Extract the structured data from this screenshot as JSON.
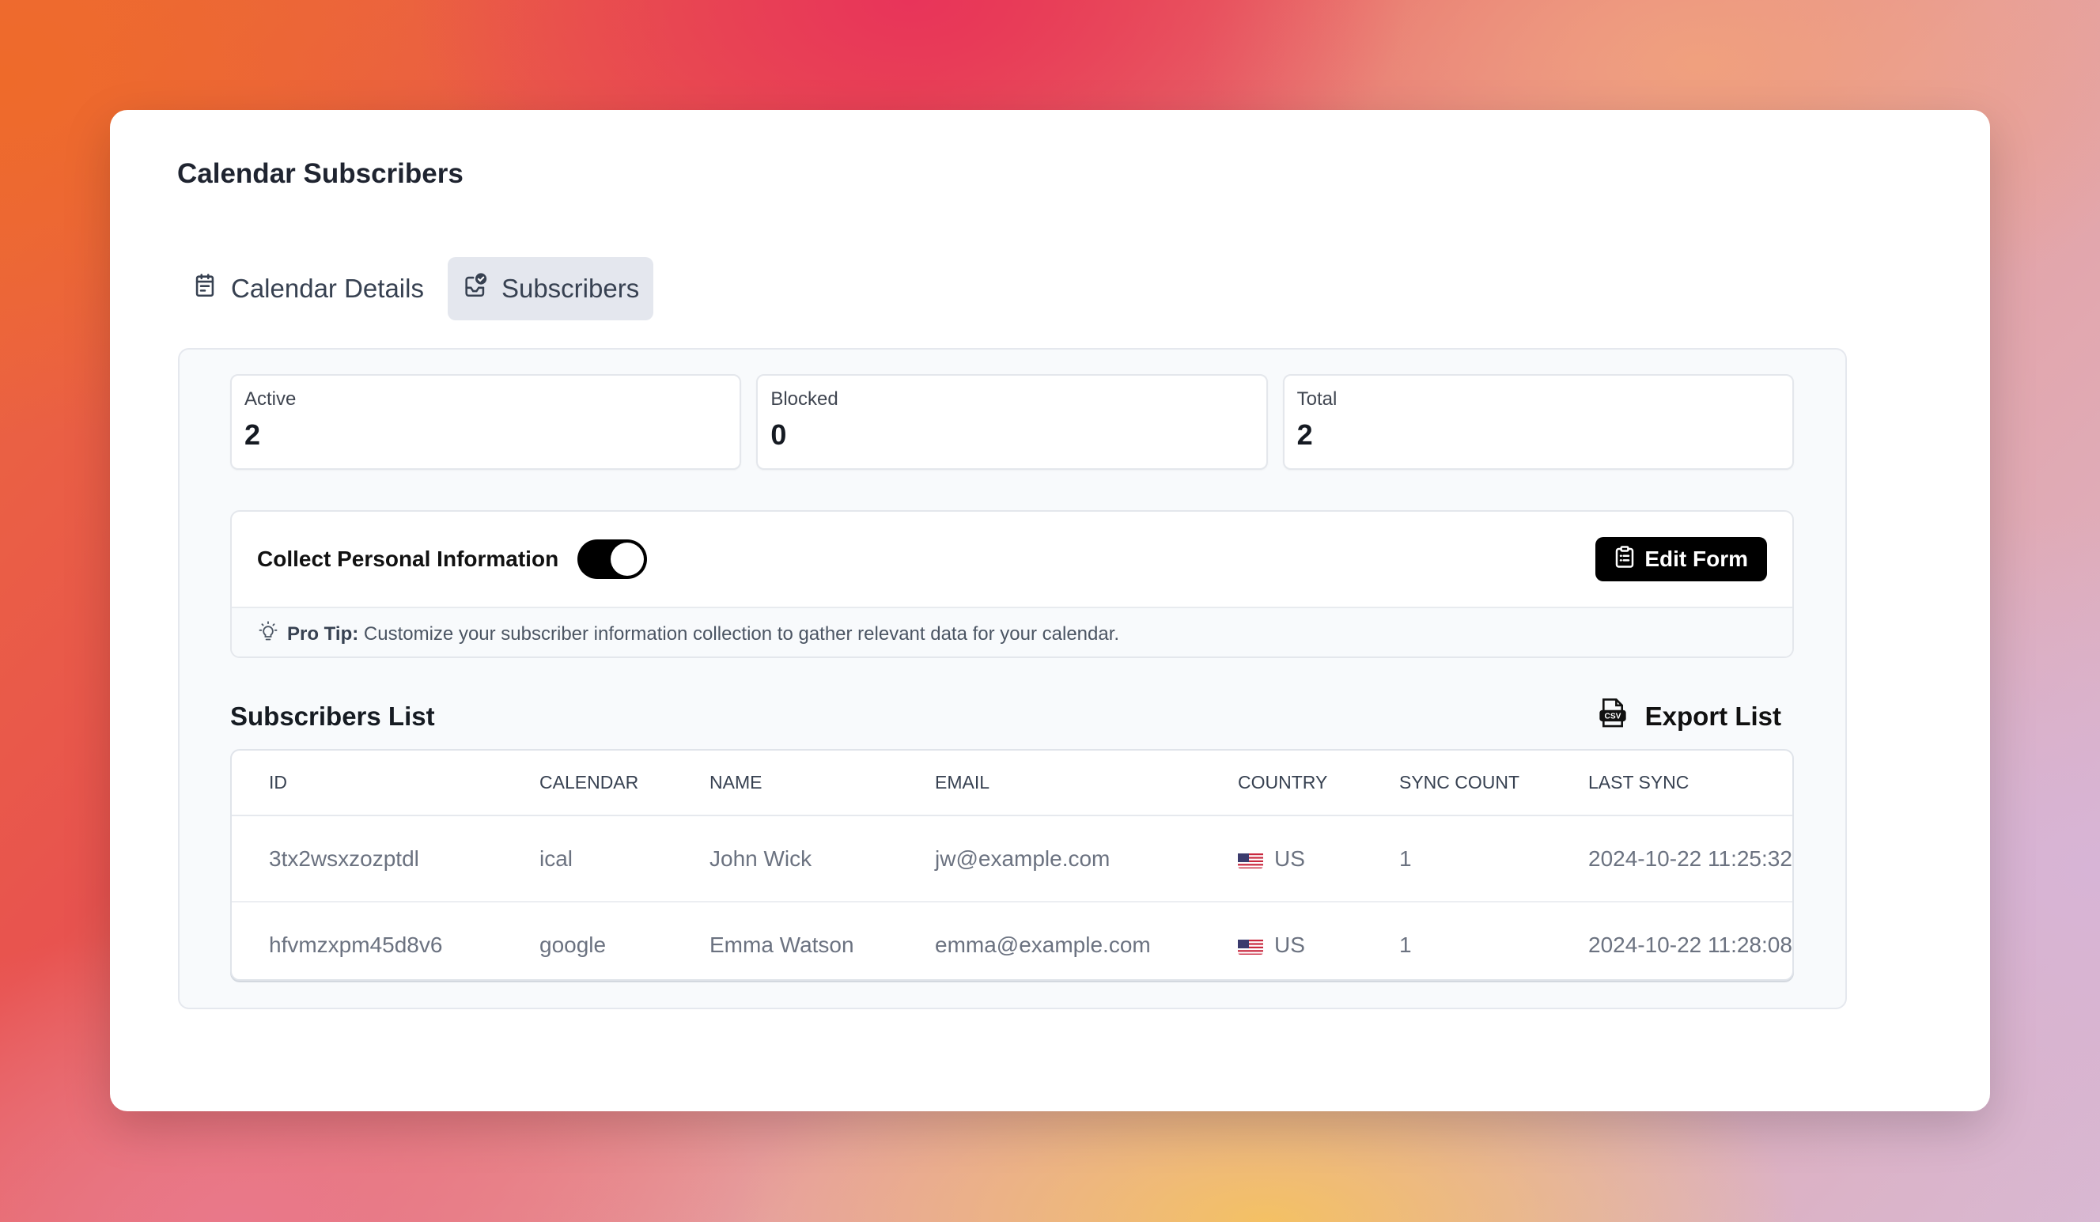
{
  "page": {
    "title": "Calendar Subscribers"
  },
  "tabs": [
    {
      "label": "Calendar Details",
      "icon": "calendar-icon",
      "active": false
    },
    {
      "label": "Subscribers",
      "icon": "subscribers-check-icon",
      "active": true
    }
  ],
  "stats": [
    {
      "label": "Active",
      "value": "2"
    },
    {
      "label": "Blocked",
      "value": "0"
    },
    {
      "label": "Total",
      "value": "2"
    }
  ],
  "settings": {
    "collect_label": "Collect Personal Information",
    "collect_enabled": true,
    "edit_form_label": "Edit Form",
    "tip_label": "Pro Tip:",
    "tip_text": " Customize your subscriber information collection to gather relevant data for your calendar."
  },
  "list": {
    "title": "Subscribers List",
    "export_label": "Export List",
    "columns": [
      "ID",
      "CALENDAR",
      "NAME",
      "EMAIL",
      "COUNTRY",
      "SYNC COUNT",
      "LAST SYNC"
    ],
    "rows": [
      {
        "id": "3tx2wsxzozptdl",
        "calendar": "ical",
        "name": "John Wick",
        "email": "jw@example.com",
        "country": "US",
        "country_flag": "us-flag-icon",
        "sync_count": "1",
        "last_sync": "2024-10-22 11:25:32"
      },
      {
        "id": "hfvmzxpm45d8v6",
        "calendar": "google",
        "name": "Emma Watson",
        "email": "emma@example.com",
        "country": "US",
        "country_flag": "us-flag-icon",
        "sync_count": "1",
        "last_sync": "2024-10-22 11:28:08"
      }
    ]
  },
  "colors": {
    "accent": "#000000",
    "active_tab_bg": "#e4e7ee",
    "panel_bg": "#f8fafc"
  }
}
